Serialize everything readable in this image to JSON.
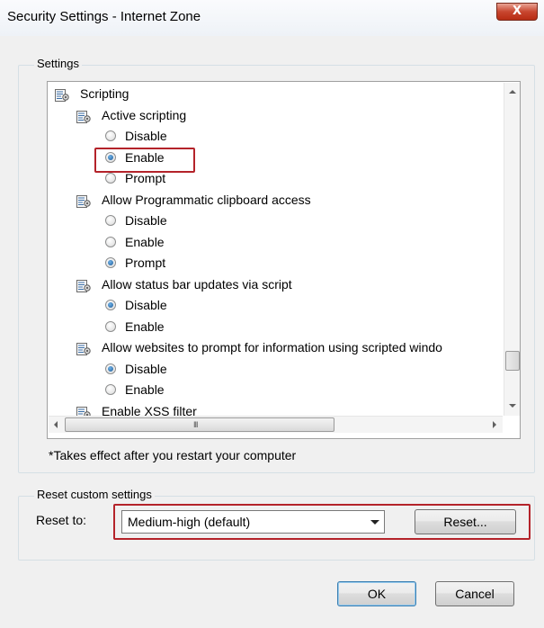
{
  "window": {
    "title": "Security Settings - Internet Zone",
    "close_label": "X"
  },
  "settings_group": {
    "label": "Settings",
    "tree": [
      {
        "type": "category",
        "label": "Scripting",
        "indent": 0
      },
      {
        "type": "setting",
        "label": "Active scripting",
        "indent": 1
      },
      {
        "type": "option",
        "label": "Disable",
        "checked": false
      },
      {
        "type": "option",
        "label": "Enable",
        "checked": true
      },
      {
        "type": "option",
        "label": "Prompt",
        "checked": false
      },
      {
        "type": "setting",
        "label": "Allow Programmatic clipboard access",
        "indent": 1
      },
      {
        "type": "option",
        "label": "Disable",
        "checked": false
      },
      {
        "type": "option",
        "label": "Enable",
        "checked": false
      },
      {
        "type": "option",
        "label": "Prompt",
        "checked": true
      },
      {
        "type": "setting",
        "label": "Allow status bar updates via script",
        "indent": 1
      },
      {
        "type": "option",
        "label": "Disable",
        "checked": true
      },
      {
        "type": "option",
        "label": "Enable",
        "checked": false
      },
      {
        "type": "setting",
        "label": "Allow websites to prompt for information using scripted windo",
        "indent": 1
      },
      {
        "type": "option",
        "label": "Disable",
        "checked": true
      },
      {
        "type": "option",
        "label": "Enable",
        "checked": false
      },
      {
        "type": "setting",
        "label": "Enable XSS filter",
        "indent": 1
      }
    ],
    "hscroll_grip": "III",
    "note": "*Takes effect after you restart your computer"
  },
  "reset_group": {
    "label": "Reset custom settings",
    "reset_to_label": "Reset to:",
    "selected_level": "Medium-high (default)",
    "reset_button": "Reset..."
  },
  "footer": {
    "ok_button": "OK",
    "cancel_button": "Cancel"
  },
  "colors": {
    "highlight": "#b4232a",
    "radio_selected": "#1d5a96"
  }
}
